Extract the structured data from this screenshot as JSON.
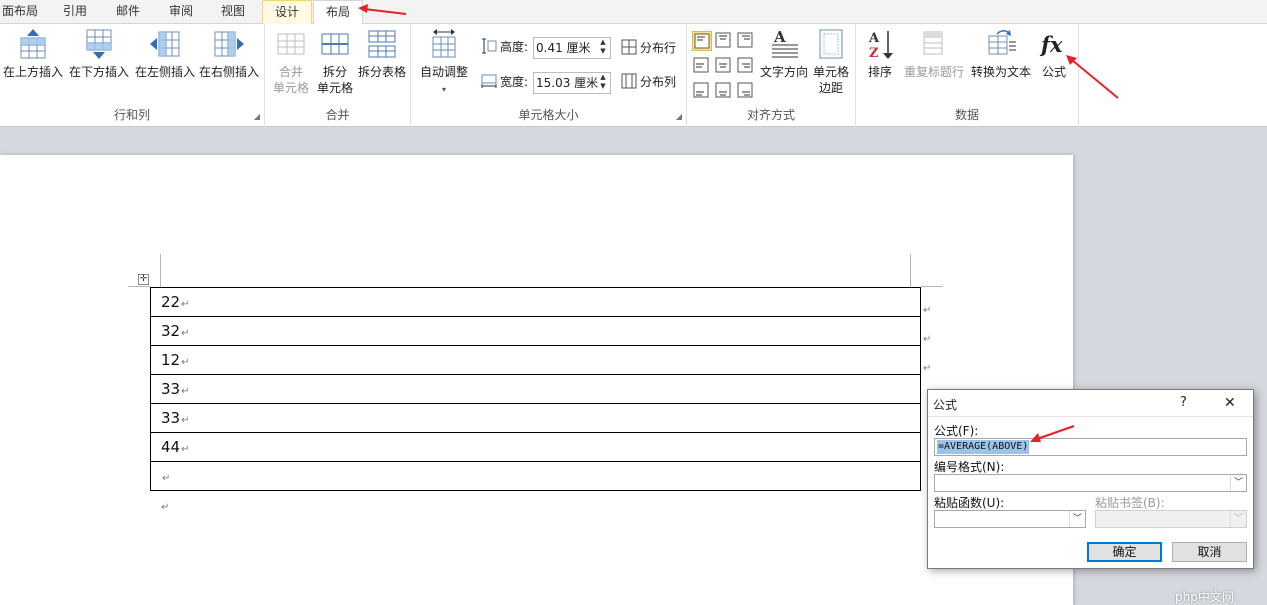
{
  "tabs": [
    "面布局",
    "引用",
    "邮件",
    "审阅",
    "视图",
    "设计",
    "布局"
  ],
  "ribbon": {
    "rows_cols": {
      "label": "行和列",
      "insert_above": "在上方插入",
      "insert_below": "在下方插入",
      "insert_left": "在左侧插入",
      "insert_right": "在右侧插入"
    },
    "merge": {
      "label": "合并",
      "merge_cells_1": "合并",
      "merge_cells_2": "单元格",
      "split_cells_1": "拆分",
      "split_cells_2": "单元格",
      "split_table": "拆分表格"
    },
    "cell_size": {
      "label": "单元格大小",
      "autofit": "自动调整",
      "height_label": "高度:",
      "height_value": "0.41 厘米",
      "width_label": "宽度:",
      "width_value": "15.03 厘米",
      "distribute_rows": "分布行",
      "distribute_cols": "分布列"
    },
    "alignment": {
      "label": "对齐方式",
      "text_direction": "文字方向",
      "cell_margins_1": "单元格",
      "cell_margins_2": "边距"
    },
    "data": {
      "label": "数据",
      "sort": "排序",
      "repeat_header": "重复标题行",
      "convert_to_text": "转换为文本",
      "formula": "公式"
    }
  },
  "document": {
    "rows": [
      "22",
      "32",
      "12",
      "33",
      "33",
      "44",
      ""
    ],
    "para_mark": "↵"
  },
  "dialog": {
    "title": "公式",
    "help": "?",
    "close": "✕",
    "formula_label": "公式(F):",
    "formula_value": "=AVERAGE(ABOVE)",
    "number_format_label": "编号格式(N):",
    "paste_function_label": "粘贴函数(U):",
    "paste_bookmark_label": "粘贴书签(B):",
    "ok": "确定",
    "cancel": "取消"
  },
  "colors": {
    "accent_arrow": "#e8202a",
    "context_tab": "#fffbe3",
    "selection": "#9cc3ec"
  },
  "watermark": "php中文网"
}
